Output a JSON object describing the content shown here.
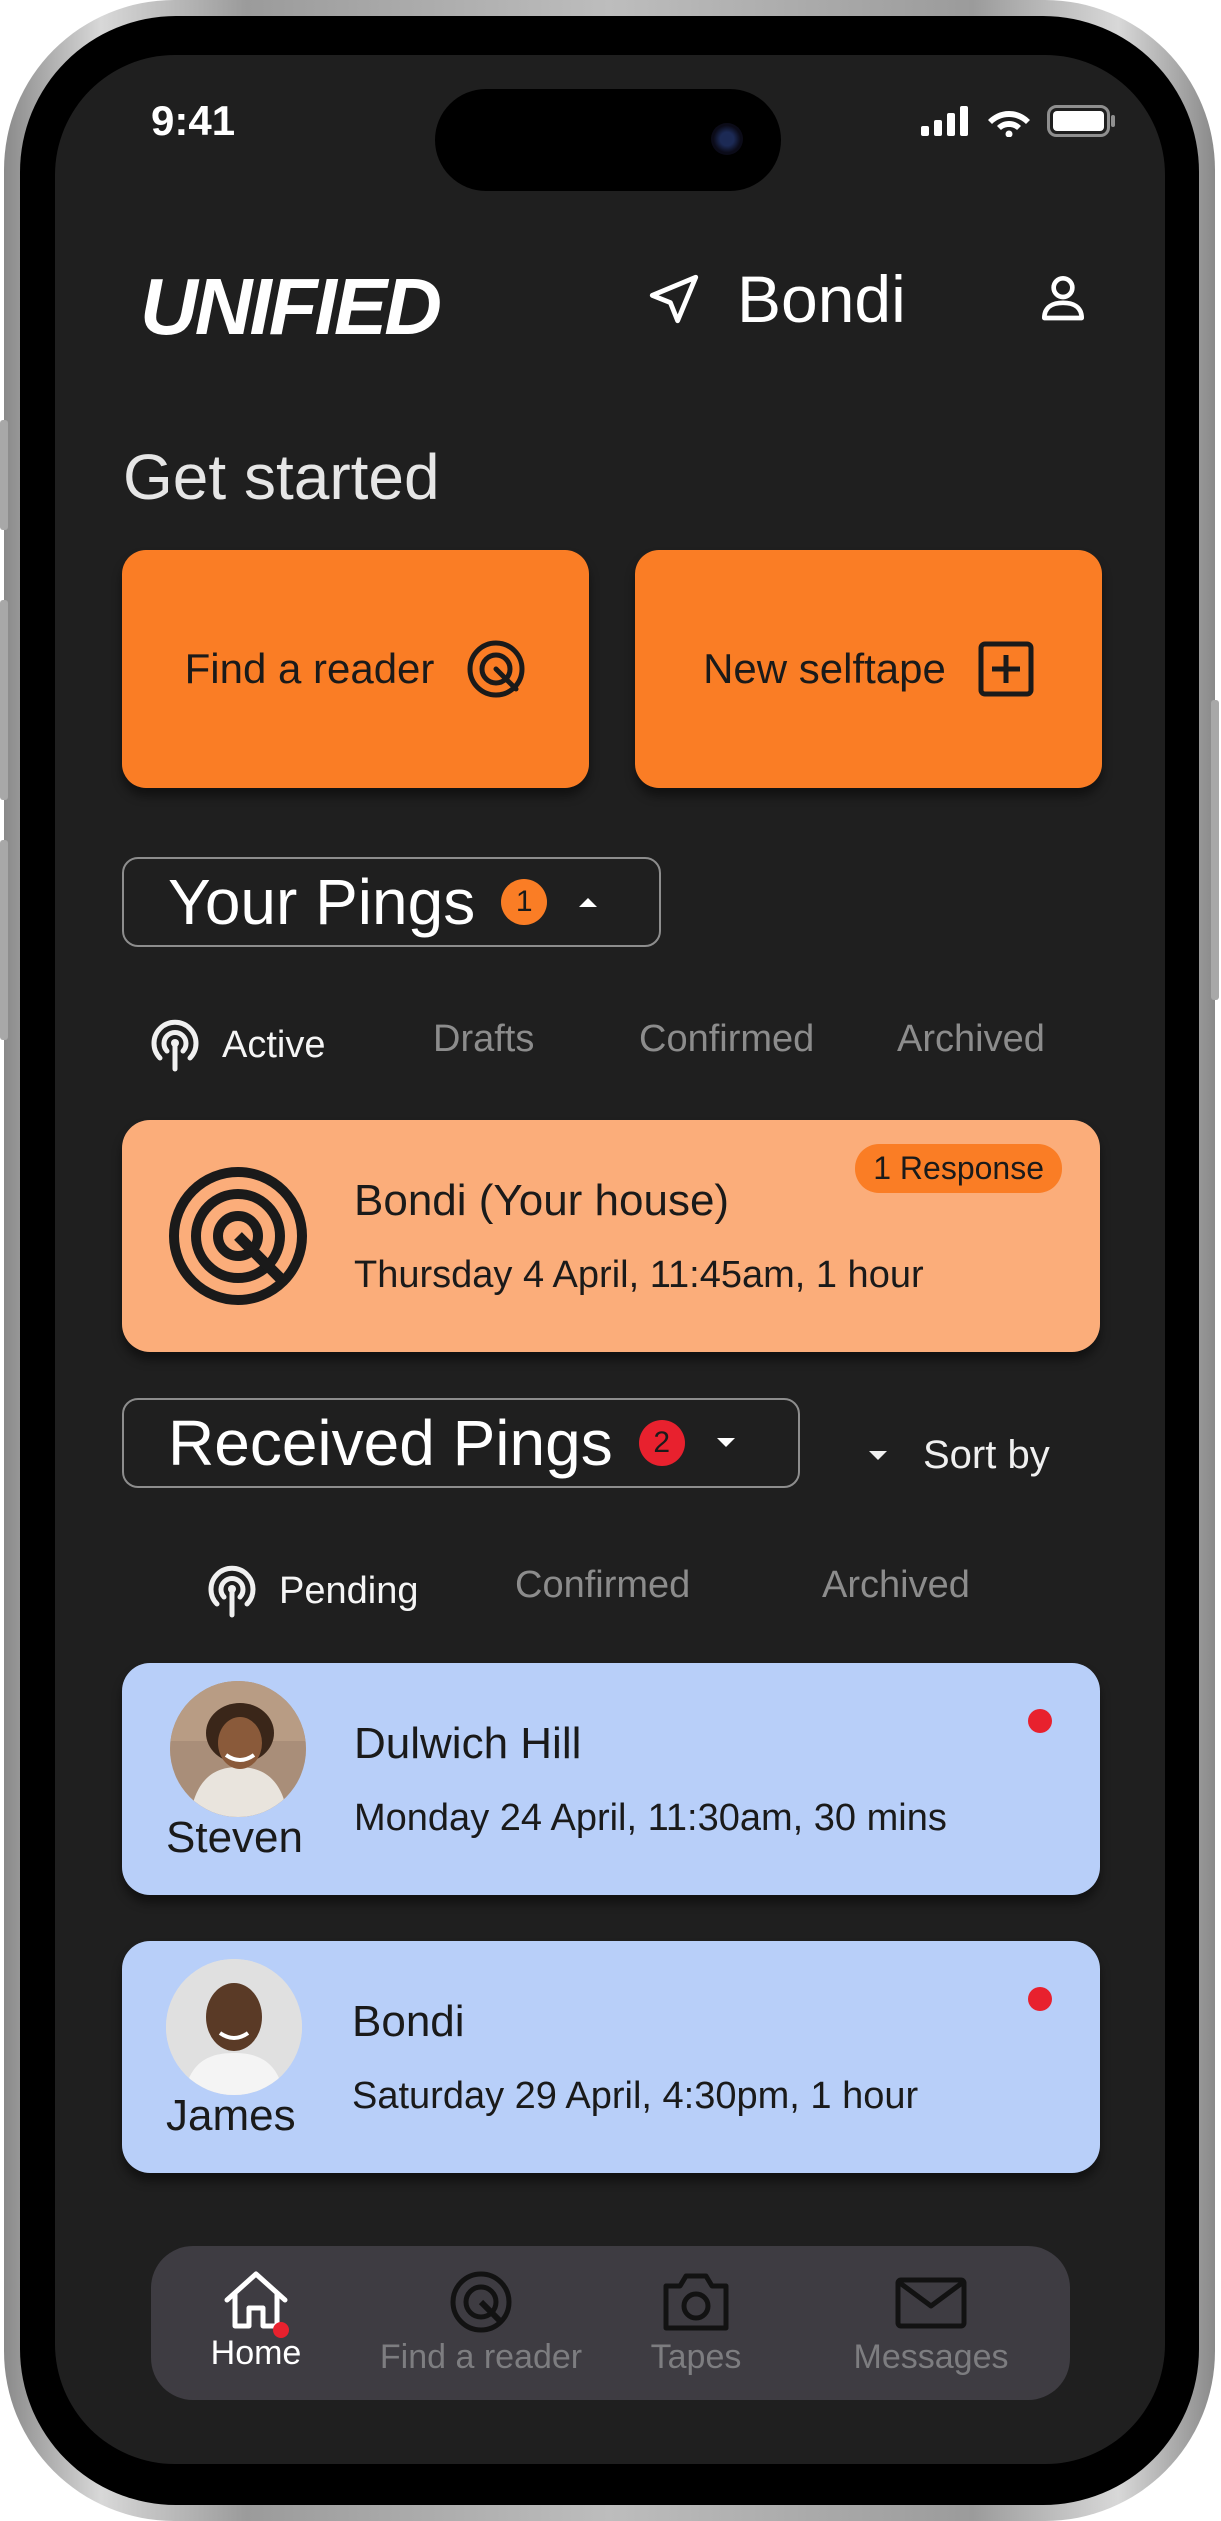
{
  "status_bar": {
    "time": "9:41"
  },
  "header": {
    "logo": "UNIFIED",
    "location": "Bondi"
  },
  "get_started": {
    "title": "Get started",
    "find_reader_label": "Find a reader",
    "new_selftape_label": "New selftape"
  },
  "your_pings": {
    "title": "Your Pings",
    "count": "1",
    "tabs": [
      {
        "label": "Active",
        "active": true
      },
      {
        "label": "Drafts"
      },
      {
        "label": "Confirmed"
      },
      {
        "label": "Archived"
      }
    ],
    "card": {
      "title": "Bondi (Your house)",
      "subtitle": "Thursday 4 April, 11:45am, 1 hour",
      "badge": "1 Response"
    }
  },
  "received_pings": {
    "title": "Received Pings",
    "count": "2",
    "sort_label": "Sort by",
    "tabs": [
      {
        "label": "Pending",
        "active": true
      },
      {
        "label": "Confirmed"
      },
      {
        "label": "Archived"
      }
    ],
    "cards": [
      {
        "name": "Steven",
        "title": "Dulwich Hill",
        "subtitle": "Monday 24 April, 11:30am, 30 mins",
        "unread": true
      },
      {
        "name": "James",
        "title": "Bondi",
        "subtitle": "Saturday 29 April, 4:30pm, 1 hour",
        "unread": true
      }
    ]
  },
  "bottom_nav": {
    "items": [
      {
        "label": "Home",
        "icon": "home-icon",
        "active": true
      },
      {
        "label": "Find a reader",
        "icon": "reader-icon"
      },
      {
        "label": "Tapes",
        "icon": "camera-icon"
      },
      {
        "label": "Messages",
        "icon": "mail-icon"
      }
    ]
  },
  "colors": {
    "accent": "#fa7d25",
    "your_ping_card": "#fbad7a",
    "received_ping_card": "#b8cff9",
    "alert": "#e8212e",
    "screen_bg": "#1f1f1f",
    "nav_bg": "#3e3c42"
  }
}
